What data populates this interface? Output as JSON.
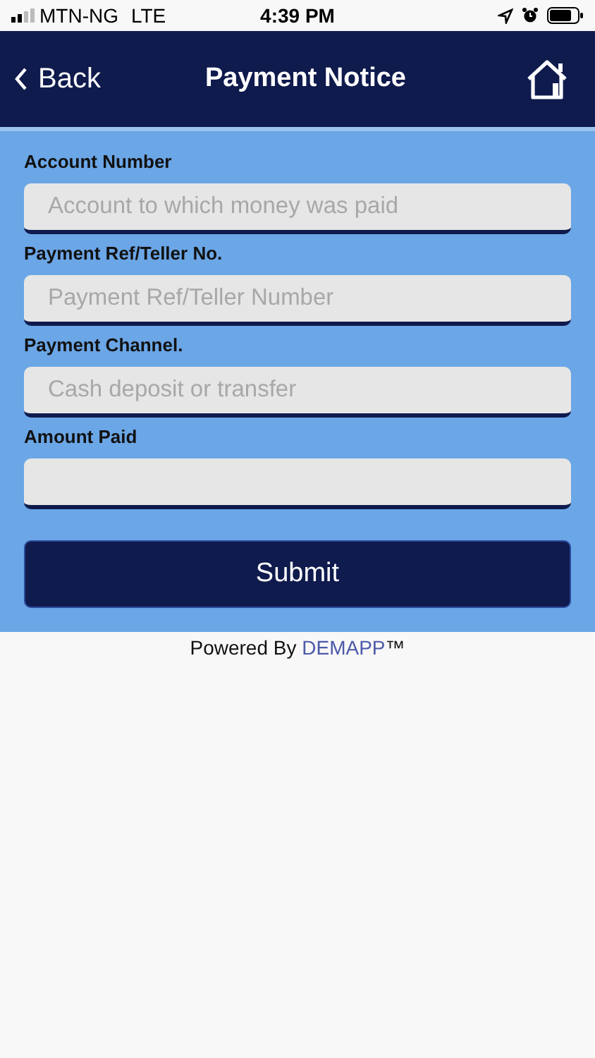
{
  "status_bar": {
    "carrier": "MTN-NG",
    "network": "LTE",
    "time": "4:39 PM"
  },
  "nav": {
    "back": "Back",
    "title": "Payment Notice"
  },
  "fields": [
    {
      "label": "Account Number",
      "placeholder": "Account to which money was paid"
    },
    {
      "label": "Payment Ref/Teller No.",
      "placeholder": "Payment Ref/Teller Number"
    },
    {
      "label": "Payment Channel.",
      "placeholder": "Cash deposit or transfer"
    },
    {
      "label": "Amount Paid"
    }
  ],
  "submit": "Submit",
  "footer": {
    "prefix": "Powered By",
    "brand": "DEMAPP",
    "suffix": "™"
  }
}
